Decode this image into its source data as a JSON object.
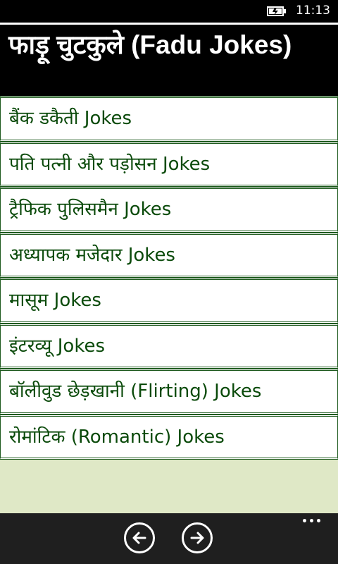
{
  "status_bar": {
    "time": "11:13",
    "battery_icon": "battery-charging-icon"
  },
  "header": {
    "title": "फाड़ू चुटकुले (Fadu Jokes)"
  },
  "categories": [
    {
      "label": "बैंक डकैती Jokes"
    },
    {
      "label": "पति पत्नी और पड़ोसन Jokes"
    },
    {
      "label": "ट्रैफिक पुलिसमैन Jokes"
    },
    {
      "label": "अध्यापक मजेदार Jokes"
    },
    {
      "label": "मासूम Jokes"
    },
    {
      "label": "इंटरव्यू Jokes"
    },
    {
      "label": "बॉलीवुड छेड़खानी (Flirting) Jokes"
    },
    {
      "label": "रोमांटिक (Romantic) Jokes"
    }
  ],
  "app_bar": {
    "back_icon": "arrow-left-icon",
    "forward_icon": "arrow-right-icon",
    "more_icon": "ellipsis-icon"
  },
  "colors": {
    "page_background": "#dfe8c6",
    "list_text": "#0a4a0a",
    "list_border": "#1e5a1e",
    "header_background": "#000000",
    "app_bar_background": "#1f1f1f"
  }
}
